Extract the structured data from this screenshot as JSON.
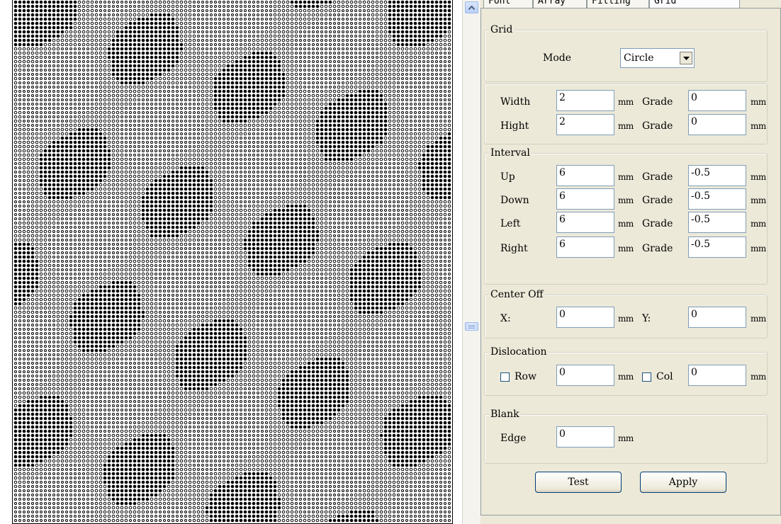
{
  "tabs": [
    {
      "label": "Font"
    },
    {
      "label": "Array"
    },
    {
      "label": "Filling"
    },
    {
      "label": "Grid",
      "active": true
    }
  ],
  "grid_group": {
    "title": "Grid",
    "mode_label": "Mode",
    "mode_value": "Circle"
  },
  "size_group": {
    "width_label": "Width",
    "width_value": "2",
    "width_grade_label": "Grade",
    "width_grade_value": "0",
    "hight_label": "Hight",
    "hight_value": "2",
    "hight_grade_label": "Grade",
    "hight_grade_value": "0",
    "unit": "mm"
  },
  "interval_group": {
    "title": "Interval",
    "rows": [
      {
        "label": "Up",
        "value": "6",
        "grade_label": "Grade",
        "grade_value": "-0.5"
      },
      {
        "label": "Down",
        "value": "6",
        "grade_label": "Grade",
        "grade_value": "-0.5"
      },
      {
        "label": "Left",
        "value": "6",
        "grade_label": "Grade",
        "grade_value": "-0.5"
      },
      {
        "label": "Right",
        "value": "6",
        "grade_label": "Grade",
        "grade_value": "-0.5"
      }
    ],
    "unit": "mm"
  },
  "center_group": {
    "title": "Center Off",
    "x_label": "X:",
    "x_value": "0",
    "y_label": "Y:",
    "y_value": "0",
    "unit": "mm"
  },
  "dislocation_group": {
    "title": "Dislocation",
    "row_label": "Row",
    "row_checked": false,
    "row_value": "0",
    "col_label": "Col",
    "col_checked": false,
    "col_value": "0",
    "unit": "mm"
  },
  "blank_group": {
    "title": "Blank",
    "edge_label": "Edge",
    "edge_value": "0",
    "unit": "mm"
  },
  "buttons": {
    "test": "Test",
    "apply": "Apply"
  },
  "icons": {
    "scroll_up": "arrow-up-icon",
    "scroll_thumb": "grip-icon",
    "dropdown": "triangle-down-icon"
  }
}
